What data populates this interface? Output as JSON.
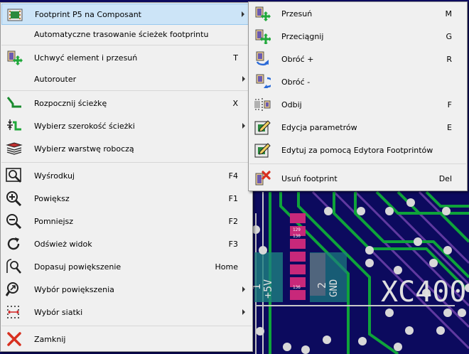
{
  "main_menu": {
    "items": [
      {
        "label": "Footprint P5 na Composant",
        "shortcut": "",
        "submenu": true,
        "icon": "footprint-module-icon"
      },
      {
        "label": "Automatyczne trasowanie ścieżek footprintu",
        "shortcut": "",
        "submenu": false,
        "icon": ""
      },
      {
        "label": "Uchwyć element i przesuń",
        "shortcut": "T",
        "submenu": false,
        "icon": "move-module-icon"
      },
      {
        "label": "Autorouter",
        "shortcut": "",
        "submenu": true,
        "icon": ""
      },
      {
        "label": "Rozpocznij ścieżkę",
        "shortcut": "X",
        "submenu": false,
        "icon": "add-track-icon"
      },
      {
        "label": "Wybierz szerokość ścieżki",
        "shortcut": "",
        "submenu": true,
        "icon": "track-width-icon"
      },
      {
        "label": "Wybierz warstwę roboczą",
        "shortcut": "",
        "submenu": false,
        "icon": "layers-icon"
      },
      {
        "label": "Wyśrodkuj",
        "shortcut": "F4",
        "submenu": false,
        "icon": "zoom-center-icon"
      },
      {
        "label": "Powiększ",
        "shortcut": "F1",
        "submenu": false,
        "icon": "zoom-in-icon"
      },
      {
        "label": "Pomniejsz",
        "shortcut": "F2",
        "submenu": false,
        "icon": "zoom-out-icon"
      },
      {
        "label": "Odśwież widok",
        "shortcut": "F3",
        "submenu": false,
        "icon": "refresh-icon"
      },
      {
        "label": "Dopasuj powiększenie",
        "shortcut": "Home",
        "submenu": false,
        "icon": "zoom-fit-icon"
      },
      {
        "label": "Wybór powiększenia",
        "shortcut": "",
        "submenu": true,
        "icon": "zoom-select-icon"
      },
      {
        "label": "Wybór siatki",
        "shortcut": "",
        "submenu": true,
        "icon": "grid-select-icon"
      },
      {
        "label": "Zamknij",
        "shortcut": "",
        "submenu": false,
        "icon": "close-icon"
      }
    ]
  },
  "sub_menu": {
    "items": [
      {
        "label": "Przesuń",
        "shortcut": "M",
        "icon": "move-module-icon"
      },
      {
        "label": "Przeciągnij",
        "shortcut": "G",
        "icon": "drag-module-icon"
      },
      {
        "label": "Obróć +",
        "shortcut": "R",
        "icon": "rotate-ccw-icon"
      },
      {
        "label": "Obróć -",
        "shortcut": "",
        "icon": "rotate-cw-icon"
      },
      {
        "label": "Odbij",
        "shortcut": "F",
        "icon": "flip-board-icon"
      },
      {
        "label": "Edycja parametrów",
        "shortcut": "E",
        "icon": "edit-module-icon"
      },
      {
        "label": "Edytuj za pomocą Edytora Footprintów",
        "shortcut": "",
        "icon": "module-editor-icon"
      },
      {
        "label": "Usuń footprint",
        "shortcut": "Del",
        "icon": "delete-module-icon"
      }
    ]
  },
  "pcb": {
    "labels": {
      "plus5v": "+5V",
      "one": "1",
      "two": "2",
      "gnd": "GND",
      "xc400": "XC400",
      "n129": "129",
      "n130": "130",
      "n136": "136"
    }
  }
}
